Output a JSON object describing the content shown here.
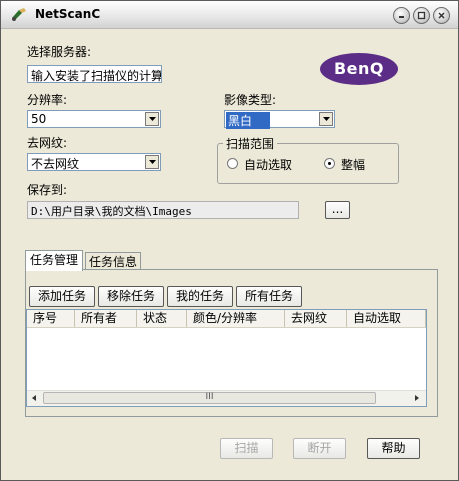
{
  "window": {
    "title": "NetScanC"
  },
  "server": {
    "label": "选择服务器:",
    "value": "输入安装了扫描仪的计算"
  },
  "brand": {
    "logo_text": "BenQ",
    "color": "#5c2d86"
  },
  "resolution": {
    "label": "分辨率:",
    "value": "50"
  },
  "image_type": {
    "label": "影像类型:",
    "value": "黑白"
  },
  "descreen": {
    "label": "去网纹:",
    "value": "不去网纹"
  },
  "scan_range": {
    "label": "扫描范围",
    "auto_label": "自动选取",
    "full_label": "整幅",
    "selected": "full"
  },
  "save_to": {
    "label": "保存到:",
    "path": "D:\\用户目录\\我的文档\\Images",
    "browse_label": "..."
  },
  "tabs": [
    {
      "label": "任务管理",
      "active": true
    },
    {
      "label": "任务信息",
      "active": false
    }
  ],
  "task_buttons": {
    "add": "添加任务",
    "remove": "移除任务",
    "mine": "我的任务",
    "all": "所有任务"
  },
  "columns": [
    "序号",
    "所有者",
    "状态",
    "颜色/分辨率",
    "去网纹",
    "自动选取"
  ],
  "scrollbar": {
    "grip": "III"
  },
  "actions": {
    "scan": "扫描",
    "disconnect": "断开",
    "help": "帮助"
  },
  "colors": {
    "selection": "#316ac5",
    "window_bg": "#ece9d8"
  }
}
